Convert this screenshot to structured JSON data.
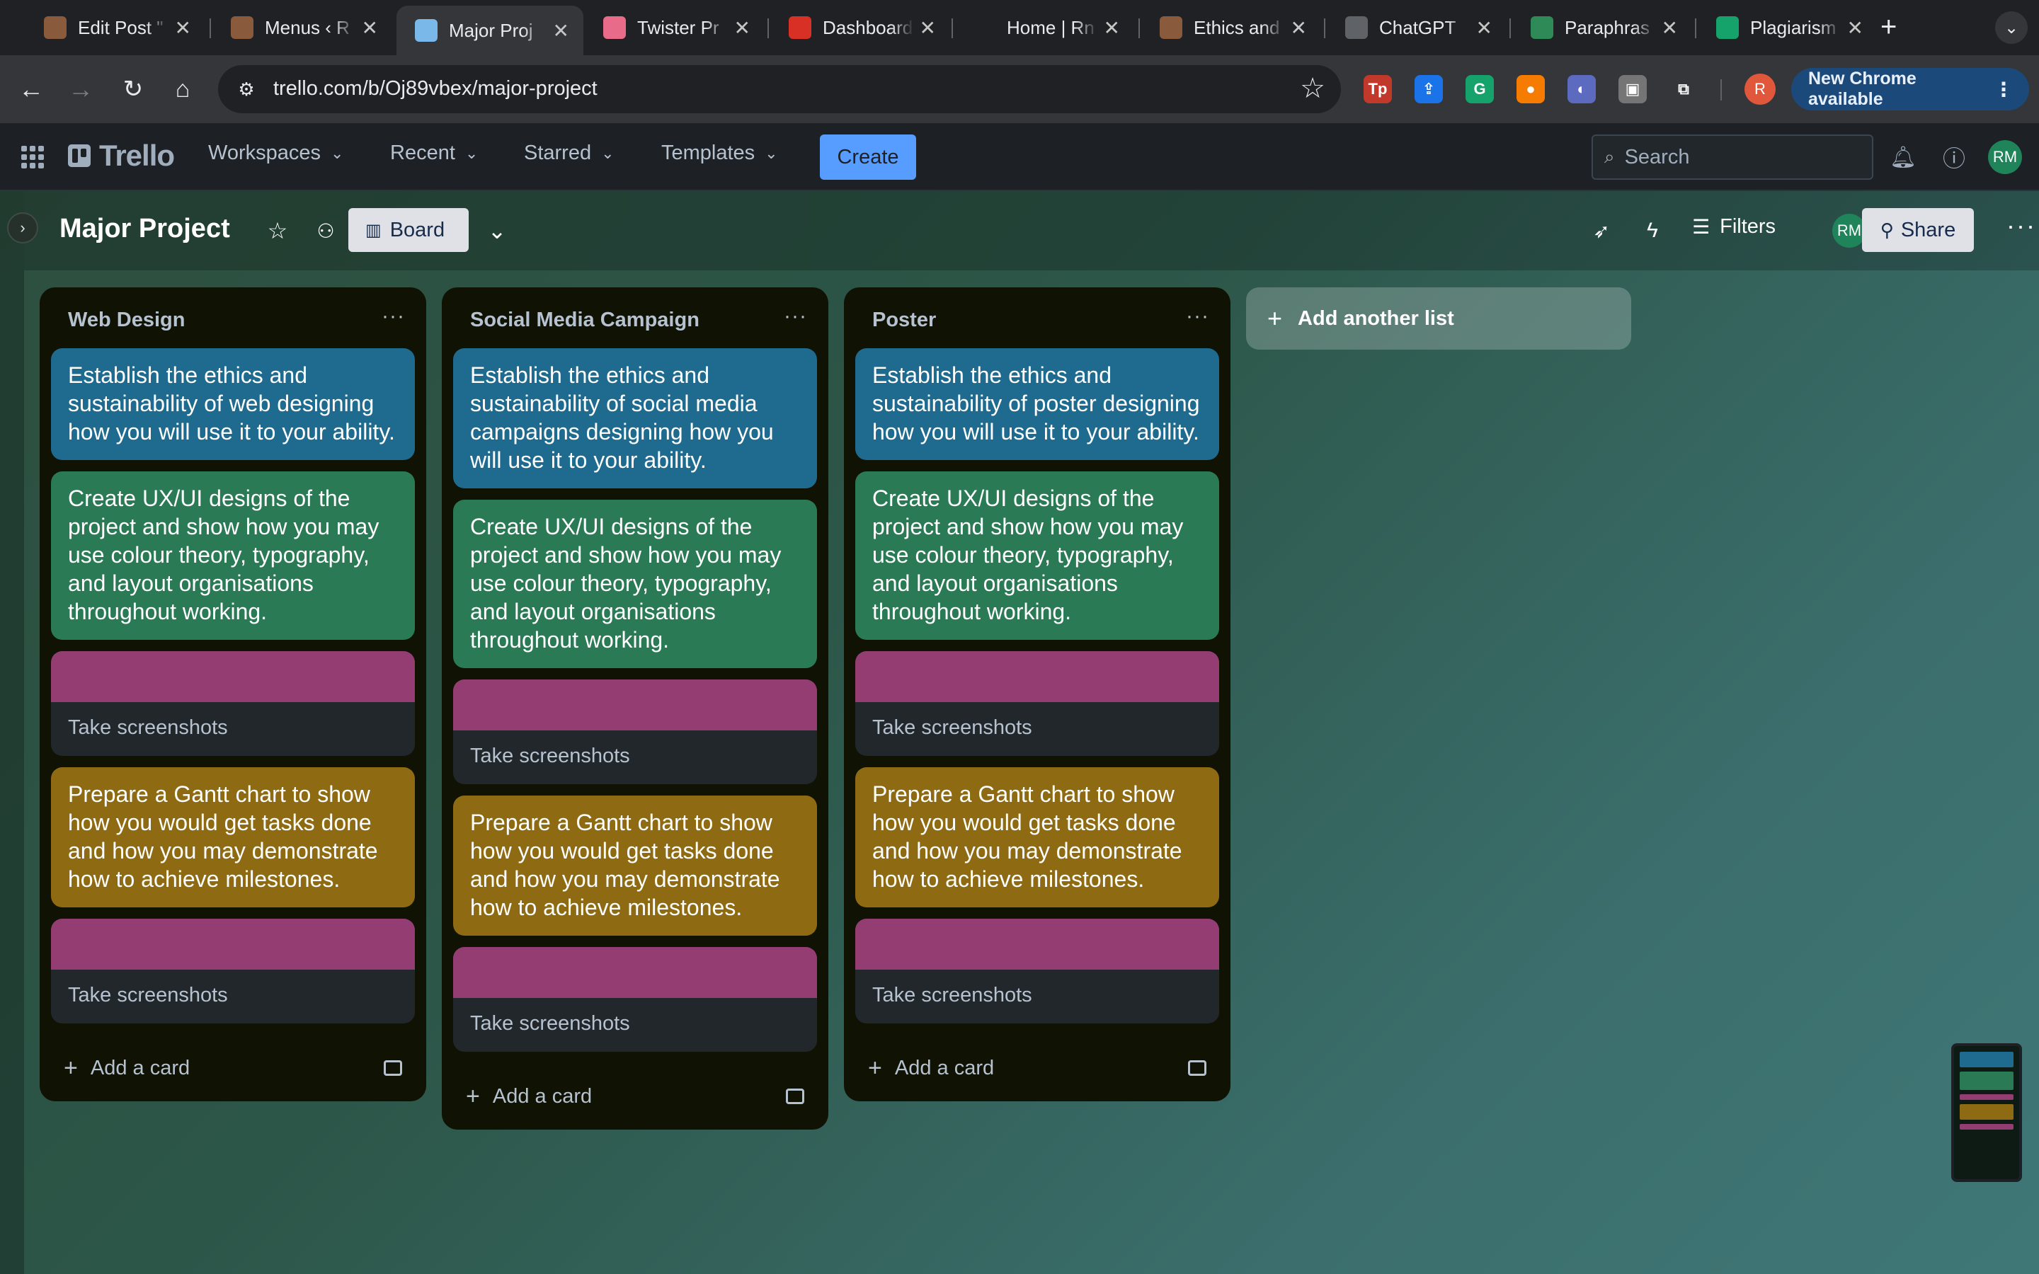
{
  "browser": {
    "tabs": [
      {
        "title": "Edit Post \"",
        "icon": "avatar-favicon",
        "color": "#8a5a3c"
      },
      {
        "title": "Menus ‹ R",
        "icon": "avatar-favicon",
        "color": "#8a5a3c"
      },
      {
        "title": "Major Proj",
        "icon": "trello-favicon",
        "color": "#79b8e8",
        "active": true
      },
      {
        "title": "Twister Pr",
        "icon": "trello-favicon",
        "color": "#e86b8a"
      },
      {
        "title": "Dashboard",
        "icon": "dashboard-favicon",
        "color": "#d93025"
      },
      {
        "title": "Home | Rn",
        "icon": "blank-favicon",
        "color": "#202124"
      },
      {
        "title": "Ethics and",
        "icon": "avatar-favicon",
        "color": "#8a5a3c"
      },
      {
        "title": "ChatGPT",
        "icon": "chatgpt-favicon",
        "color": "#5f6368"
      },
      {
        "title": "Paraphras",
        "icon": "robot-favicon",
        "color": "#2e8b57"
      },
      {
        "title": "Plagiarism",
        "icon": "grammarly-favicon",
        "color": "#15a36b"
      }
    ],
    "url": "trello.com/b/Oj89vbex/major-project",
    "new_chrome_label": "New Chrome available",
    "profile_initial": "R",
    "extensions": [
      {
        "name": "tp-extension-icon",
        "glyph": "Tp",
        "color": "#c0392b"
      },
      {
        "name": "upload-extension-icon",
        "glyph": "⇪",
        "color": "#1a73e8"
      },
      {
        "name": "grammarly-extension-icon",
        "glyph": "G",
        "color": "#15a36b"
      },
      {
        "name": "orange-extension-icon",
        "glyph": "●",
        "color": "#f57c00"
      },
      {
        "name": "globe-extension-icon",
        "glyph": "◐",
        "color": "#5c6bc0"
      },
      {
        "name": "grey-extension-icon",
        "glyph": "▣",
        "color": "#757575"
      },
      {
        "name": "puzzle-extensions-icon",
        "glyph": "⧉",
        "color": "#35363a"
      }
    ]
  },
  "trello": {
    "logo": "Trello",
    "nav": [
      "Workspaces",
      "Recent",
      "Starred",
      "Templates"
    ],
    "create_label": "Create",
    "search_placeholder": "Search",
    "user_initials": "RM"
  },
  "board": {
    "title": "Major Project",
    "view_label": "Board",
    "filters_label": "Filters",
    "share_label": "Share",
    "member_initials": "RM",
    "add_list_label": "Add another list",
    "add_card_label": "Add a card",
    "lists": [
      {
        "title": "Web Design",
        "cards": [
          {
            "style": "blue",
            "text": "Establish the ethics and sustainability of web designing how you will use it to your ability."
          },
          {
            "style": "green",
            "text": "Create UX/UI designs of the project and show how you may use colour theory, typography, and layout organisations throughout working."
          },
          {
            "style": "cover",
            "text": "Take screenshots"
          },
          {
            "style": "yellow",
            "text": "Prepare a Gantt chart to show how you would get tasks done and how you may demonstrate how to achieve milestones."
          },
          {
            "style": "cover",
            "text": "Take screenshots"
          }
        ]
      },
      {
        "title": "Social Media Campaign",
        "cards": [
          {
            "style": "blue",
            "text": "Establish the ethics and sustainability of social media campaigns designing how you will use it to your ability."
          },
          {
            "style": "green",
            "text": "Create UX/UI designs of the project and show how you may use colour theory, typography, and layout organisations throughout working."
          },
          {
            "style": "cover",
            "text": "Take screenshots"
          },
          {
            "style": "yellow",
            "text": "Prepare a Gantt chart to show how you would get tasks done and how you may demonstrate how to achieve milestones."
          },
          {
            "style": "cover",
            "text": "Take screenshots"
          }
        ]
      },
      {
        "title": "Poster",
        "cards": [
          {
            "style": "blue",
            "text": "Establish the ethics and sustainability of poster designing how you will use it to your ability."
          },
          {
            "style": "green",
            "text": "Create UX/UI designs of the project and show how you may use colour theory, typography, and layout organisations throughout working."
          },
          {
            "style": "cover",
            "text": "Take screenshots"
          },
          {
            "style": "yellow",
            "text": "Prepare a Gantt chart to show how you would get tasks done and how you may demonstrate how to achieve milestones."
          },
          {
            "style": "cover",
            "text": "Take screenshots"
          }
        ]
      }
    ]
  },
  "colors": {
    "card_blue": "#1f6a8f",
    "card_green": "#2a7a56",
    "card_yellow": "#8e6b12",
    "cover_magenta": "#943d73",
    "create_blue": "#579dff"
  }
}
